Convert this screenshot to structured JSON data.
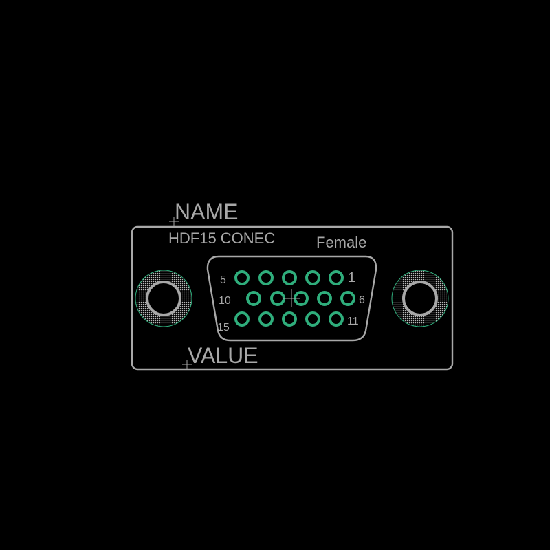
{
  "footprint": {
    "name_label": "NAME",
    "value_label": "VALUE",
    "part_label": "HDF15 CONEC",
    "gender_label": "Female",
    "pin_labels": {
      "pin_1": "1",
      "pin_5": "5",
      "pin_6": "6",
      "pin_10": "10",
      "pin_11": "11",
      "pin_15": "15"
    },
    "pads": {
      "row_1": [
        "1",
        "2",
        "3",
        "4",
        "5"
      ],
      "row_2": [
        "6",
        "7",
        "8",
        "9",
        "10"
      ],
      "row_3": [
        "11",
        "12",
        "13",
        "14",
        "15"
      ]
    },
    "mounting_holes": [
      "left",
      "right"
    ]
  },
  "colors": {
    "background": "#000000",
    "silkscreen": "#a8a8a8",
    "pad": "#2fae7c",
    "courtyard": "#2fae7c",
    "hole_fill": "#b8b8b8"
  }
}
